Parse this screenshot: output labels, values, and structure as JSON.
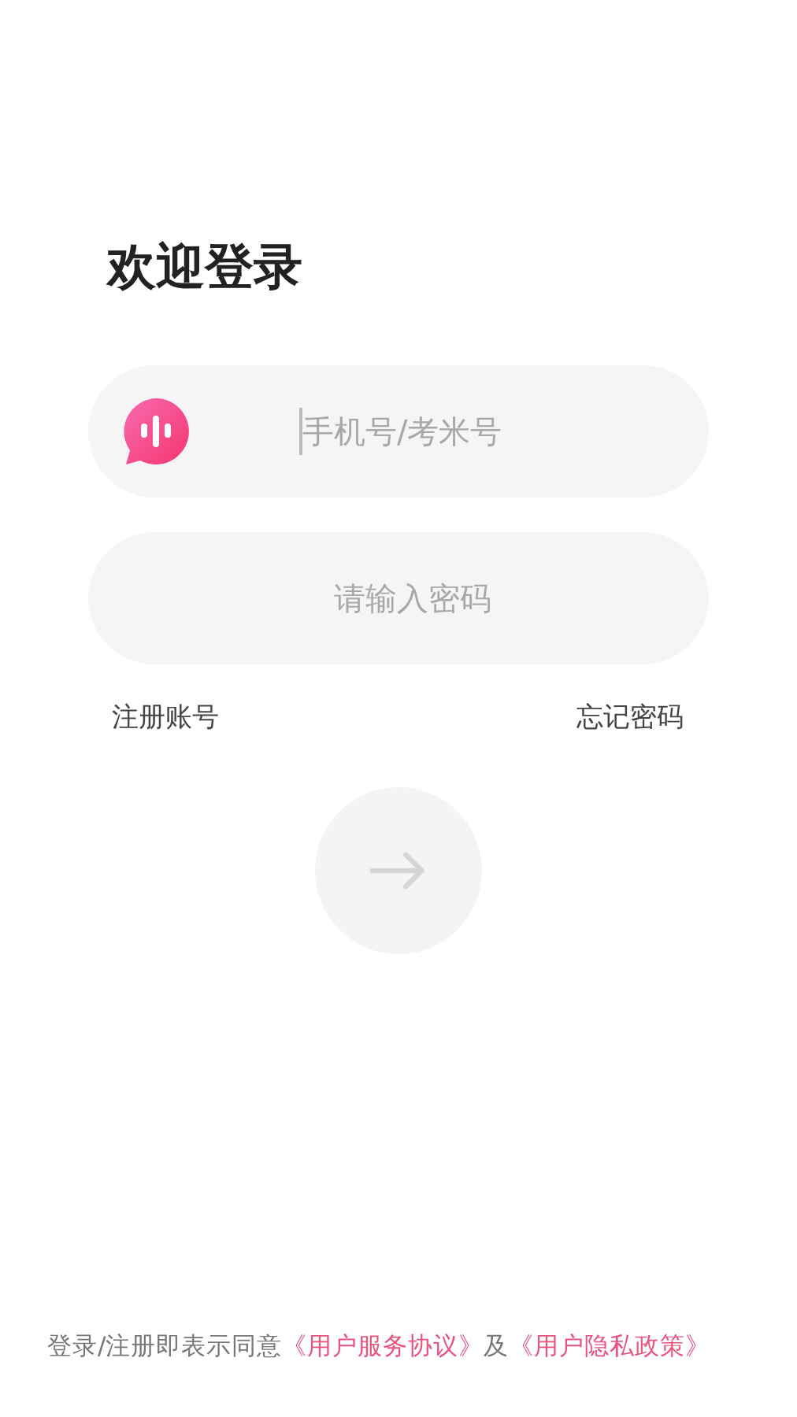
{
  "title": "欢迎登录",
  "fields": [
    {
      "kind": "account",
      "placeholder": "手机号/考米号",
      "focused": true
    },
    {
      "kind": "password",
      "placeholder": "请输入密码",
      "focused": false
    }
  ],
  "links": [
    "注册账号",
    "忘记密码"
  ],
  "agreement": {
    "prefix": "登录/注册即表示同意",
    "terms": "《用户服务协议》",
    "joiner": "及",
    "privacy": "《用户隐私政策》"
  }
}
